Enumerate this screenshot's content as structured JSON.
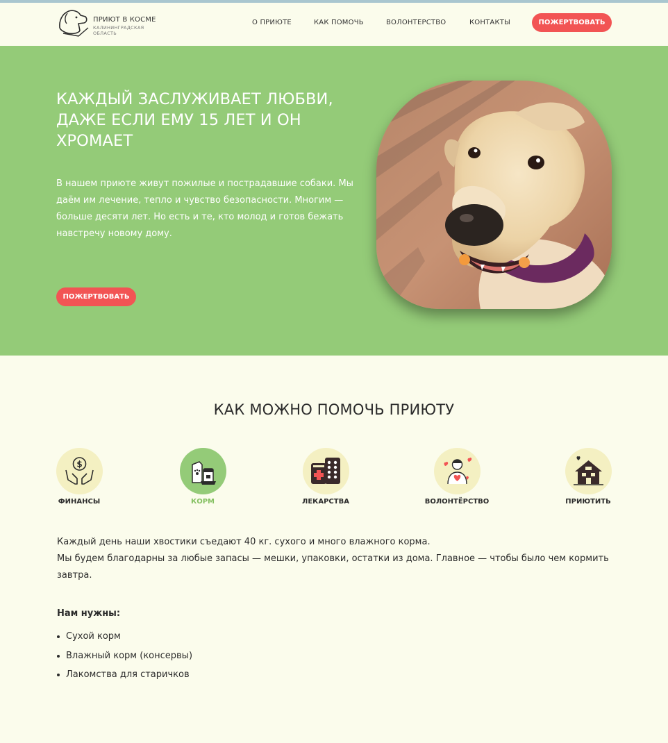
{
  "header": {
    "logo_title": "ПРИЮТ В КОСМЕ",
    "logo_subtitle": "КАЛИНИНГРАДСКАЯ ОБЛАСТЬ",
    "nav": [
      {
        "label": "О ПРИЮТЕ"
      },
      {
        "label": "КАК ПОМОЧЬ"
      },
      {
        "label": "ВОЛОНТЕРСТВО"
      },
      {
        "label": "КОНТАКТЫ"
      }
    ],
    "donate_label": "ПОЖЕРТВОВАТЬ"
  },
  "hero": {
    "title": "КАЖДЫЙ ЗАСЛУЖИВАЕТ ЛЮБВИ, ДАЖЕ ЕСЛИ ЕМУ 15 ЛЕТ И ОН ХРОМАЕТ",
    "text": "В нашем приюте живут пожилые и пострадавшие собаки. Мы даём им лечение, тепло и чувство безопасности. Многим — больше десяти лет. Но есть и те, кто молод и готов бежать навстречу новому дому.",
    "donate_label": "ПОЖЕРТВОВАТЬ",
    "photo_alt": "dog-photo"
  },
  "help": {
    "title": "КАК МОЖНО ПОМОЧЬ ПРИЮТУ",
    "categories": [
      {
        "label": "ФИНАНСЫ",
        "icon": "money-hands-icon",
        "active": false
      },
      {
        "label": "КОРМ",
        "icon": "pet-food-icon",
        "active": true
      },
      {
        "label": "ЛЕКАРСТВА",
        "icon": "medicine-icon",
        "active": false
      },
      {
        "label": "ВОЛОНТЁРСТВО",
        "icon": "volunteer-icon",
        "active": false
      },
      {
        "label": "ПРИЮТИТЬ",
        "icon": "house-heart-icon",
        "active": false
      }
    ],
    "paragraph_1": "Каждый день наши хвостики съедают 40 кг. сухого и много влажного корма.",
    "paragraph_2": "Мы будем благодарны за любые запасы — мешки, упаковки, остатки из дома. Главное — чтобы было чем кормить завтра.",
    "needs_title": "Нам нужны:",
    "needs": [
      "Сухой корм",
      "Влажный корм (консервы)",
      "Лакомства для старичков"
    ]
  },
  "colors": {
    "accent_green": "#94cb78",
    "donate_red": "#f25454",
    "background": "#fbfcec",
    "icon_circle": "#f4f0c2"
  }
}
